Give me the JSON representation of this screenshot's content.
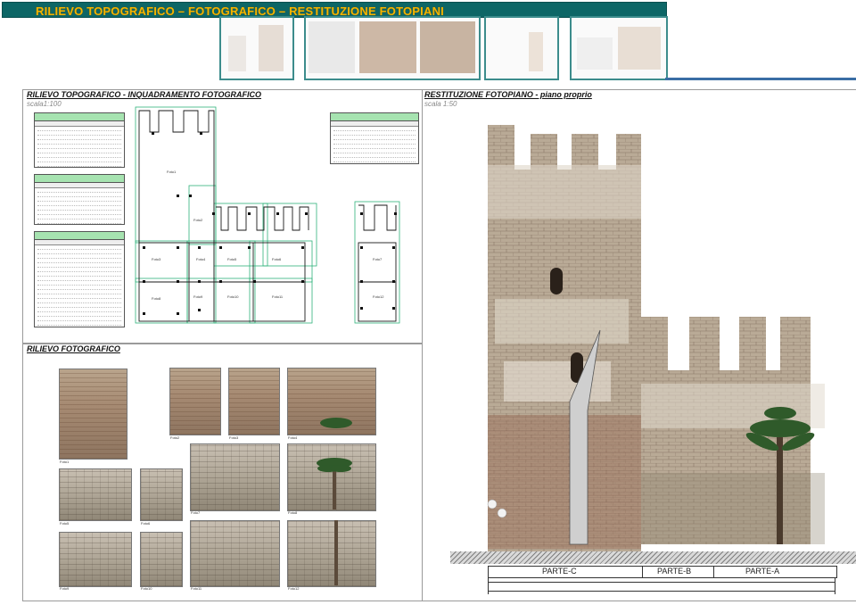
{
  "header": {
    "title": "RILIEVO TOPOGRAFICO – FOTOGRAFICO – RESTITUZIONE FOTOPIANI",
    "accent_color": "#f2b400",
    "bar_color": "#0d6666"
  },
  "panels": {
    "topo": {
      "title": "RILIEVO TOPOGRAFICO - INQUADRAMENTO FOTOGRAFICO",
      "scale": "scala1:100"
    },
    "foto": {
      "title": "RILIEVO FOTOGRAFICO"
    },
    "fotopiano": {
      "title": "RESTITUZIONE FOTOPIANO - piano proprio",
      "scale": "scala 1:50"
    }
  },
  "plan_photos": [
    "Foto1",
    "Foto2",
    "Foto3",
    "Foto4",
    "Foto5",
    "Foto6",
    "Foto7",
    "Foto8",
    "Foto9",
    "Foto10",
    "Foto11",
    "Foto12"
  ],
  "photo_captions": [
    "Foto1",
    "Foto2",
    "Foto3",
    "Foto4",
    "Foto5",
    "Foto6",
    "Foto7",
    "Foto8",
    "Foto9",
    "Foto10",
    "Foto11",
    "Foto12"
  ],
  "facade": {
    "parts": [
      "PARTE-C",
      "PARTE-B",
      "PARTE-A"
    ]
  }
}
